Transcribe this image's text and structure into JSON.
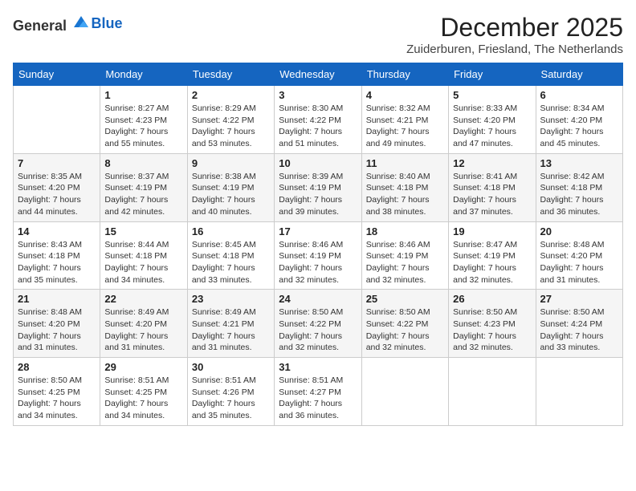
{
  "logo": {
    "general": "General",
    "blue": "Blue"
  },
  "header": {
    "month": "December 2025",
    "location": "Zuiderburen, Friesland, The Netherlands"
  },
  "days_of_week": [
    "Sunday",
    "Monday",
    "Tuesday",
    "Wednesday",
    "Thursday",
    "Friday",
    "Saturday"
  ],
  "weeks": [
    [
      {
        "day": "",
        "info": ""
      },
      {
        "day": "1",
        "info": "Sunrise: 8:27 AM\nSunset: 4:23 PM\nDaylight: 7 hours\nand 55 minutes."
      },
      {
        "day": "2",
        "info": "Sunrise: 8:29 AM\nSunset: 4:22 PM\nDaylight: 7 hours\nand 53 minutes."
      },
      {
        "day": "3",
        "info": "Sunrise: 8:30 AM\nSunset: 4:22 PM\nDaylight: 7 hours\nand 51 minutes."
      },
      {
        "day": "4",
        "info": "Sunrise: 8:32 AM\nSunset: 4:21 PM\nDaylight: 7 hours\nand 49 minutes."
      },
      {
        "day": "5",
        "info": "Sunrise: 8:33 AM\nSunset: 4:20 PM\nDaylight: 7 hours\nand 47 minutes."
      },
      {
        "day": "6",
        "info": "Sunrise: 8:34 AM\nSunset: 4:20 PM\nDaylight: 7 hours\nand 45 minutes."
      }
    ],
    [
      {
        "day": "7",
        "info": "Sunrise: 8:35 AM\nSunset: 4:20 PM\nDaylight: 7 hours\nand 44 minutes."
      },
      {
        "day": "8",
        "info": "Sunrise: 8:37 AM\nSunset: 4:19 PM\nDaylight: 7 hours\nand 42 minutes."
      },
      {
        "day": "9",
        "info": "Sunrise: 8:38 AM\nSunset: 4:19 PM\nDaylight: 7 hours\nand 40 minutes."
      },
      {
        "day": "10",
        "info": "Sunrise: 8:39 AM\nSunset: 4:19 PM\nDaylight: 7 hours\nand 39 minutes."
      },
      {
        "day": "11",
        "info": "Sunrise: 8:40 AM\nSunset: 4:18 PM\nDaylight: 7 hours\nand 38 minutes."
      },
      {
        "day": "12",
        "info": "Sunrise: 8:41 AM\nSunset: 4:18 PM\nDaylight: 7 hours\nand 37 minutes."
      },
      {
        "day": "13",
        "info": "Sunrise: 8:42 AM\nSunset: 4:18 PM\nDaylight: 7 hours\nand 36 minutes."
      }
    ],
    [
      {
        "day": "14",
        "info": "Sunrise: 8:43 AM\nSunset: 4:18 PM\nDaylight: 7 hours\nand 35 minutes."
      },
      {
        "day": "15",
        "info": "Sunrise: 8:44 AM\nSunset: 4:18 PM\nDaylight: 7 hours\nand 34 minutes."
      },
      {
        "day": "16",
        "info": "Sunrise: 8:45 AM\nSunset: 4:18 PM\nDaylight: 7 hours\nand 33 minutes."
      },
      {
        "day": "17",
        "info": "Sunrise: 8:46 AM\nSunset: 4:19 PM\nDaylight: 7 hours\nand 32 minutes."
      },
      {
        "day": "18",
        "info": "Sunrise: 8:46 AM\nSunset: 4:19 PM\nDaylight: 7 hours\nand 32 minutes."
      },
      {
        "day": "19",
        "info": "Sunrise: 8:47 AM\nSunset: 4:19 PM\nDaylight: 7 hours\nand 32 minutes."
      },
      {
        "day": "20",
        "info": "Sunrise: 8:48 AM\nSunset: 4:20 PM\nDaylight: 7 hours\nand 31 minutes."
      }
    ],
    [
      {
        "day": "21",
        "info": "Sunrise: 8:48 AM\nSunset: 4:20 PM\nDaylight: 7 hours\nand 31 minutes."
      },
      {
        "day": "22",
        "info": "Sunrise: 8:49 AM\nSunset: 4:20 PM\nDaylight: 7 hours\nand 31 minutes."
      },
      {
        "day": "23",
        "info": "Sunrise: 8:49 AM\nSunset: 4:21 PM\nDaylight: 7 hours\nand 31 minutes."
      },
      {
        "day": "24",
        "info": "Sunrise: 8:50 AM\nSunset: 4:22 PM\nDaylight: 7 hours\nand 32 minutes."
      },
      {
        "day": "25",
        "info": "Sunrise: 8:50 AM\nSunset: 4:22 PM\nDaylight: 7 hours\nand 32 minutes."
      },
      {
        "day": "26",
        "info": "Sunrise: 8:50 AM\nSunset: 4:23 PM\nDaylight: 7 hours\nand 32 minutes."
      },
      {
        "day": "27",
        "info": "Sunrise: 8:50 AM\nSunset: 4:24 PM\nDaylight: 7 hours\nand 33 minutes."
      }
    ],
    [
      {
        "day": "28",
        "info": "Sunrise: 8:50 AM\nSunset: 4:25 PM\nDaylight: 7 hours\nand 34 minutes."
      },
      {
        "day": "29",
        "info": "Sunrise: 8:51 AM\nSunset: 4:25 PM\nDaylight: 7 hours\nand 34 minutes."
      },
      {
        "day": "30",
        "info": "Sunrise: 8:51 AM\nSunset: 4:26 PM\nDaylight: 7 hours\nand 35 minutes."
      },
      {
        "day": "31",
        "info": "Sunrise: 8:51 AM\nSunset: 4:27 PM\nDaylight: 7 hours\nand 36 minutes."
      },
      {
        "day": "",
        "info": ""
      },
      {
        "day": "",
        "info": ""
      },
      {
        "day": "",
        "info": ""
      }
    ]
  ]
}
